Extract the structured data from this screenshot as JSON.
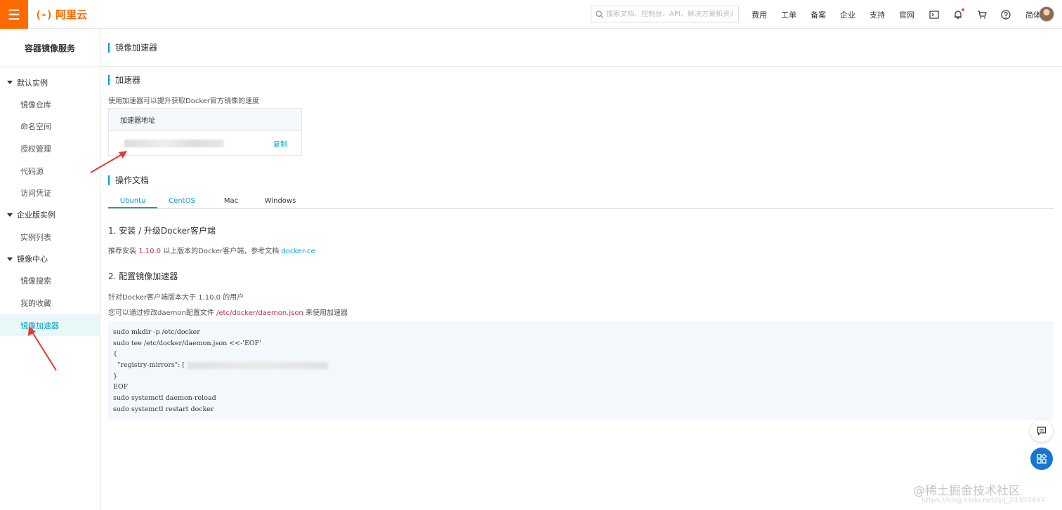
{
  "header": {
    "menu_icon": "hamburger-icon",
    "logo_text": "阿里云",
    "logo_mark": "(-)",
    "search_placeholder": "搜索文档、控制台、API、解决方案和资源",
    "links": [
      "费用",
      "工单",
      "备案",
      "企业",
      "支持",
      "官网"
    ],
    "icons": [
      "terminal-icon",
      "bell-icon",
      "cart-icon",
      "help-icon"
    ],
    "lang": "简体",
    "accent": "#ff6a00"
  },
  "sidebar": {
    "title": "容器镜像服务",
    "groups": [
      {
        "label": "默认实例",
        "items": [
          "镜像仓库",
          "命名空间",
          "授权管理",
          "代码源",
          "访问凭证"
        ]
      },
      {
        "label": "企业版实例",
        "items": [
          "实例列表"
        ]
      },
      {
        "label": "镜像中心",
        "items": [
          "镜像搜索",
          "我的收藏",
          "镜像加速器"
        ]
      }
    ],
    "active_item": "镜像加速器",
    "active_color": "#00a2ca"
  },
  "main": {
    "page_title": "镜像加速器",
    "accelerator": {
      "section_title": "加速器",
      "description": "使用加速器可以提升获取Docker官方镜像的速度",
      "box_header": "加速器地址",
      "copy_label": "复制"
    },
    "docs": {
      "section_title": "操作文档",
      "tabs": [
        "Ubuntu",
        "CentOS",
        "Mac",
        "Windows"
      ],
      "active_tab": "Ubuntu",
      "step1_title": "1. 安装 / 升级Docker客户端",
      "step1_text_before": "推荐安装",
      "step1_version": "1.10.0",
      "step1_text_middle": "以上版本的Docker客户端，参考文档",
      "step1_link": "docker-ce",
      "step2_title": "2. 配置镜像加速器",
      "step2_line1": "针对Docker客户端版本大于 1.10.0 的用户",
      "step2_line2_before": "您可以通过修改daemon配置文件",
      "step2_path": "/etc/docker/daemon.json",
      "step2_line2_after": "来使用加速器",
      "code_lines": [
        "sudo mkdir -p /etc/docker",
        "sudo tee /etc/docker/daemon.json <<-'EOF'",
        "{",
        "  \"registry-mirrors\": [",
        "}",
        "EOF",
        "sudo systemctl daemon-reload",
        "sudo systemctl restart docker"
      ]
    }
  },
  "watermark": {
    "text": "@稀土掘金技术社区",
    "url": "https://blog.csdn.net/qq_23359487"
  }
}
